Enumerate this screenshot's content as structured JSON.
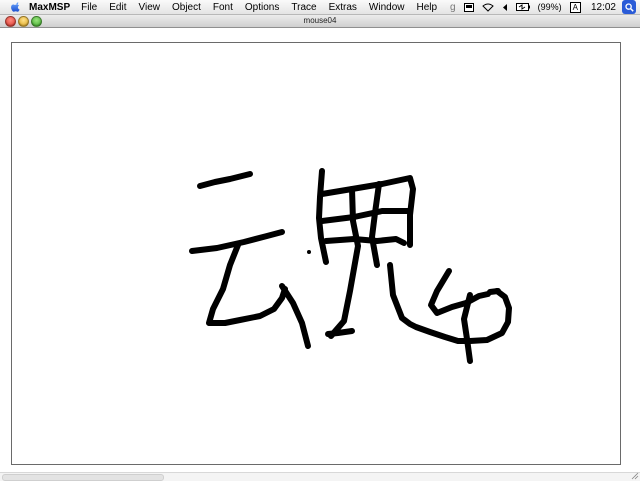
{
  "menubar": {
    "app_name": "MaxMSP",
    "items": [
      "File",
      "Edit",
      "View",
      "Object",
      "Font",
      "Options",
      "Trace",
      "Extras",
      "Window",
      "Help"
    ],
    "battery": "(99%)",
    "input_menu": "A",
    "clock": "12:02",
    "status_glyph": "g"
  },
  "window": {
    "title": "mouse04"
  },
  "drawing": {
    "stroke_color": "#000000",
    "background": "#ffffff"
  }
}
